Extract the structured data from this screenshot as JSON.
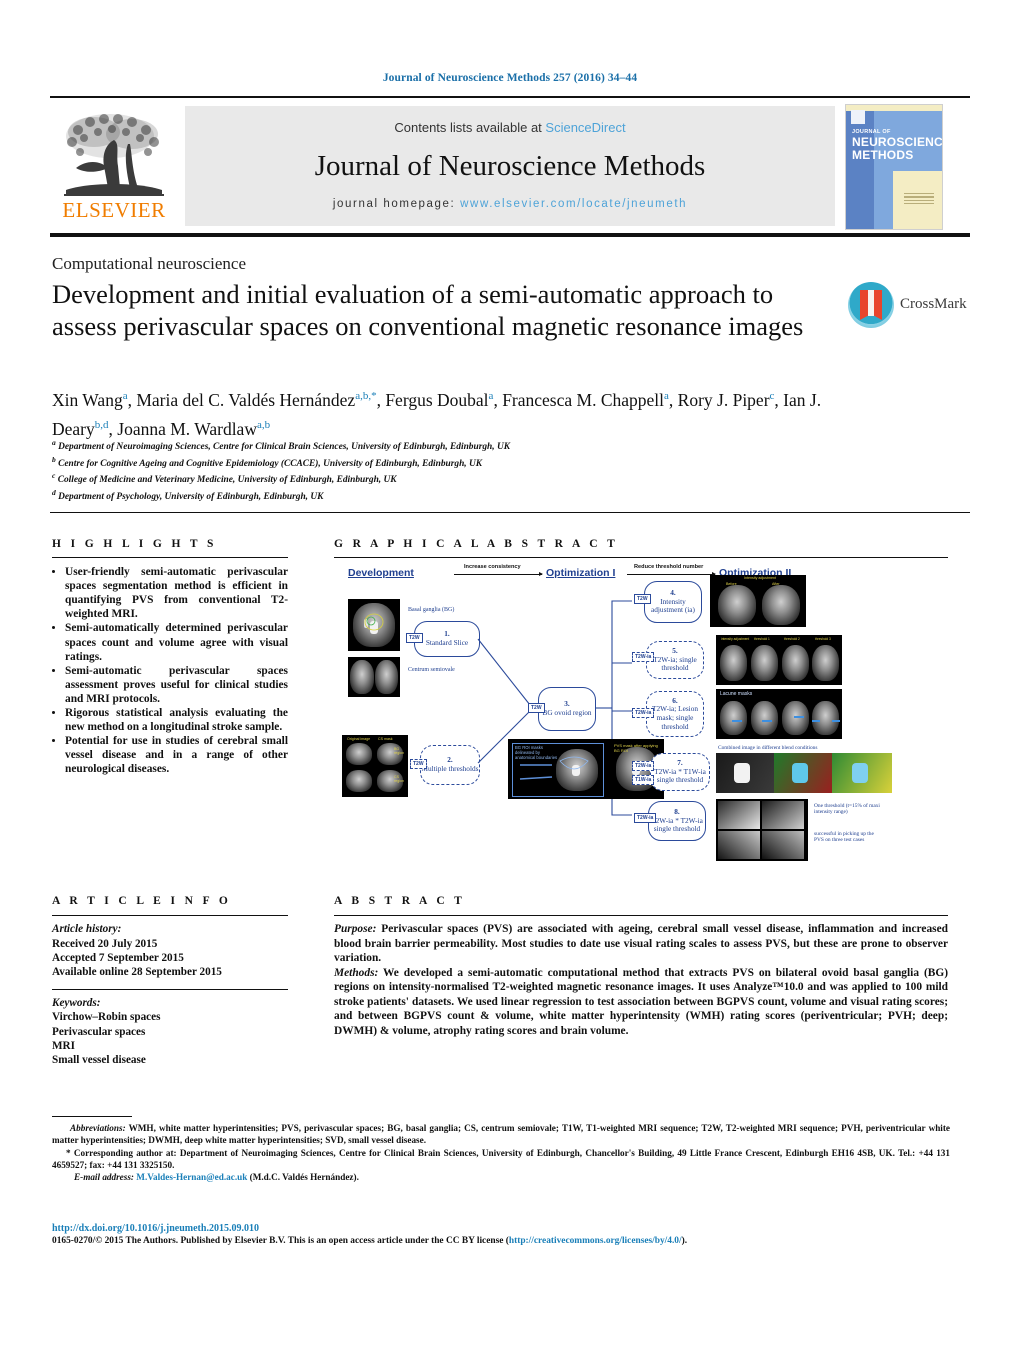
{
  "running_head": "Journal of Neuroscience Methods 257 (2016) 34–44",
  "masthead": {
    "publisher_name": "ELSEVIER",
    "contents_prefix": "Contents lists available at ",
    "contents_link": "ScienceDirect",
    "journal_title": "Journal of Neuroscience Methods",
    "homepage_prefix": "journal homepage: ",
    "homepage_url": "www.elsevier.com/locate/jneumeth",
    "cover_line1": "JOURNAL OF",
    "cover_line2": "NEUROSCIENCE METHODS"
  },
  "article": {
    "section": "Computational neuroscience",
    "title": "Development and initial evaluation of a semi-automatic approach to assess perivascular spaces on conventional magnetic resonance images",
    "crossmark_label": "CrossMark",
    "authors_html": "Xin Wang<sup>a</sup>, Maria del C. Valdés Hernández<sup>a,b,</sup><sup>*</sup>, Fergus Doubal<sup>a</sup>, Francesca M. Chappell<sup>a</sup>, Rory J. Piper<sup>c</sup>, Ian J. Deary<sup>b,d</sup>, Joanna M. Wardlaw<sup>a,b</sup>",
    "affiliations": [
      {
        "key": "a",
        "text": "Department of Neuroimaging Sciences, Centre for Clinical Brain Sciences, University of Edinburgh, Edinburgh, UK"
      },
      {
        "key": "b",
        "text": "Centre for Cognitive Ageing and Cognitive Epidemiology (CCACE), University of Edinburgh, Edinburgh, UK"
      },
      {
        "key": "c",
        "text": "College of Medicine and Veterinary Medicine, University of Edinburgh, Edinburgh, UK"
      },
      {
        "key": "d",
        "text": "Department of Psychology, University of Edinburgh, Edinburgh, UK"
      }
    ]
  },
  "highlights": {
    "heading": "H I G H L I G H T S",
    "items": [
      "User-friendly semi-automatic perivascular spaces segmentation method is efficient in quantifying PVS from conventional T2-weighted MRI.",
      "Semi-automatically determined perivascular spaces count and volume agree with visual ratings.",
      "Semi-automatic perivascular spaces assessment proves useful for clinical studies and MRI protocols.",
      "Rigorous statistical analysis evaluating the new method on a longitudinal stroke sample.",
      "Potential for use in studies of cerebral small vessel disease and in a range of other neurological diseases."
    ]
  },
  "graphical_abstract": {
    "heading": "G R A P H I C A L   A B S T R A C T",
    "stages": [
      "Development",
      "Optimization I",
      "Optimization II"
    ],
    "arrow_labels": [
      "Increase consistency",
      "Reduce threshold number"
    ],
    "nodes": [
      {
        "num": "1.",
        "label": "Standard Slice",
        "tags": [
          "T2W"
        ]
      },
      {
        "num": "2.",
        "label": "Multiple thresholds",
        "tags": [
          "T2W"
        ]
      },
      {
        "num": "3.",
        "label": "BG ovoid region",
        "tags": [
          "T2W"
        ]
      },
      {
        "num": "4.",
        "label": "Intensity adjustment (ia)",
        "tags": [
          "T2W"
        ]
      },
      {
        "num": "5.",
        "label": "T2W-ia; single threshold",
        "tags": [
          "T2W-ia"
        ]
      },
      {
        "num": "6.",
        "label": "T2W-ia; Lesion mask; single threshold",
        "tags": [
          "T2W-ia"
        ]
      },
      {
        "num": "7.",
        "label": "T2W-ia * T1W-ia single threshold",
        "tags": [
          "T2W-ia",
          "T1W-ia"
        ]
      },
      {
        "num": "8.",
        "label": "T2W-ia * T2W-ia single threshold",
        "tags": [
          "T2W-ia"
        ]
      }
    ],
    "image_labels": {
      "basal_ganglia": "Basal ganglia (BG)",
      "centrum": "Centrum semiovale",
      "original_image": "Original image",
      "cs_mask": "CS mask",
      "bg_region": "BG region",
      "cs_region": "CS region",
      "bg_roi": "BG ROI masks delineated by anatomical boundaries",
      "pvs_mask": "PVS mask after applying BG ROI",
      "intensity_adjustment": "Intensity adjustment",
      "before": "Before",
      "after": "After",
      "lacune_masks": "Lacune masks",
      "combined": "Combined image in different blend conditions",
      "note1": "One threshold (t=15% of maxi intensity range)",
      "note2": "successful in picking up the PVS on three test cases"
    }
  },
  "article_info": {
    "heading": "A R T I C L E   I N F O",
    "history_label": "Article history:",
    "history": [
      "Received 20 July 2015",
      "Accepted 7 September 2015",
      "Available online 28 September 2015"
    ],
    "keywords_label": "Keywords:",
    "keywords": [
      "Virchow–Robin spaces",
      "Perivascular spaces",
      "MRI",
      "Small vessel disease"
    ]
  },
  "abstract": {
    "heading": "A B S T R A C T",
    "purpose_label": "Purpose:",
    "purpose_text": " Perivascular spaces (PVS) are associated with ageing, cerebral small vessel disease, inflammation and increased blood brain barrier permeability. Most studies to date use visual rating scales to assess PVS, but these are prone to observer variation.",
    "methods_label": "Methods:",
    "methods_text": " We developed a semi-automatic computational method that extracts PVS on bilateral ovoid basal ganglia (BG) regions on intensity-normalised T2-weighted magnetic resonance images. It uses Analyze™10.0 and was applied to 100 mild stroke patients' datasets. We used linear regression to test association between BGPVS count, volume and visual rating scores; and between BGPVS count & volume, white matter hyperintensity (WMH) rating scores (periventricular; PVH; deep; DWMH) & volume, atrophy rating scores and brain volume."
  },
  "footnotes": {
    "abbreviations_label": "Abbreviations:",
    "abbreviations_text": " WMH, white matter hyperintensities; PVS, perivascular spaces; BG, basal ganglia; CS, centrum semiovale; T1W, T1-weighted MRI sequence; T2W, T2-weighted MRI sequence; PVH, periventricular white matter hyperintensities; DWMH, deep white matter hyperintensities; SVD, small vessel disease.",
    "corresponding_text": "* Corresponding author at: Department of Neuroimaging Sciences, Centre for Clinical Brain Sciences, University of Edinburgh, Chancellor's Building, 49 Little France Crescent, Edinburgh EH16 4SB, UK. Tel.: +44 131 4659527; fax: +44 131 3325150.",
    "email_label": "E-mail address:",
    "email_address": "M.Valdes-Hernan@ed.ac.uk",
    "email_owner": " (M.d.C. Valdés Hernández).",
    "doi_url": "http://dx.doi.org/10.1016/j.jneumeth.2015.09.010",
    "copyright_pre": "0165-0270/© 2015 The Authors. Published by Elsevier B.V. This is an open access article under the CC BY license (",
    "license_url": "http://creativecommons.org/licenses/by/4.0/",
    "copyright_post": ")."
  },
  "colors": {
    "link_blue": "#1a7fb8",
    "sciencedirect_blue": "#4ea3d8",
    "elsevier_orange": "#f07d00",
    "diagram_blue": "#1f3f8f",
    "cover_blue": "#7fa8dd"
  }
}
